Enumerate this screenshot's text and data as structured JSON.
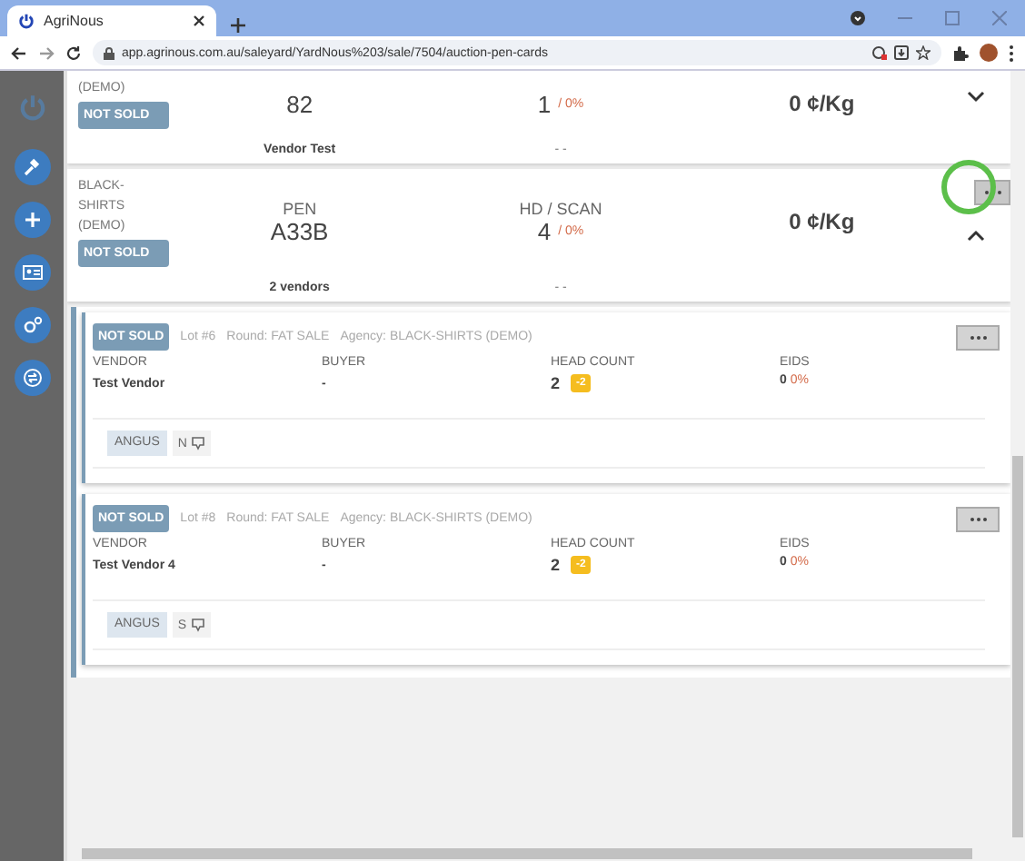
{
  "browser": {
    "tab_title": "AgriNous",
    "url": "app.agrinous.com.au/saleyard/YardNous%203/sale/7504/auction-pen-cards"
  },
  "pens": [
    {
      "agency": "(DEMO)",
      "status": "NOT SOLD",
      "pen": "82",
      "hd": "1",
      "hd_pct": "/ 0%",
      "price": "0 ¢/Kg",
      "expanded": false,
      "vendors": "Vendor Test",
      "dash": "- -"
    },
    {
      "agency": "BLACK-SHIRTS (DEMO)",
      "status": "NOT SOLD",
      "pen_label": "PEN",
      "pen": "A33B",
      "hd_label": "HD / SCAN",
      "hd": "4",
      "hd_pct": "/ 0%",
      "price": "0 ¢/Kg",
      "expanded": true,
      "vendors": "2 vendors",
      "dash": "- -"
    }
  ],
  "lots": [
    {
      "status": "NOT SOLD",
      "lot": "Lot #6",
      "round": "Round: FAT SALE",
      "agency": "Agency: BLACK-SHIRTS (DEMO)",
      "vendor_label": "VENDOR",
      "vendor": "Test Vendor",
      "buyer_label": "BUYER",
      "buyer": "-",
      "head_label": "HEAD COUNT",
      "head": "2",
      "head_badge": "-2",
      "eids_label": "EIDS",
      "eids": "0",
      "eids_pct": "0%",
      "breed": "ANGUS",
      "sex": "N"
    },
    {
      "status": "NOT SOLD",
      "lot": "Lot #8",
      "round": "Round: FAT SALE",
      "agency": "Agency: BLACK-SHIRTS (DEMO)",
      "vendor_label": "VENDOR",
      "vendor": "Test Vendor 4",
      "buyer_label": "BUYER",
      "buyer": "-",
      "head_label": "HEAD COUNT",
      "head": "2",
      "head_badge": "-2",
      "eids_label": "EIDS",
      "eids": "0",
      "eids_pct": "0%",
      "breed": "ANGUS",
      "sex": "S"
    }
  ]
}
